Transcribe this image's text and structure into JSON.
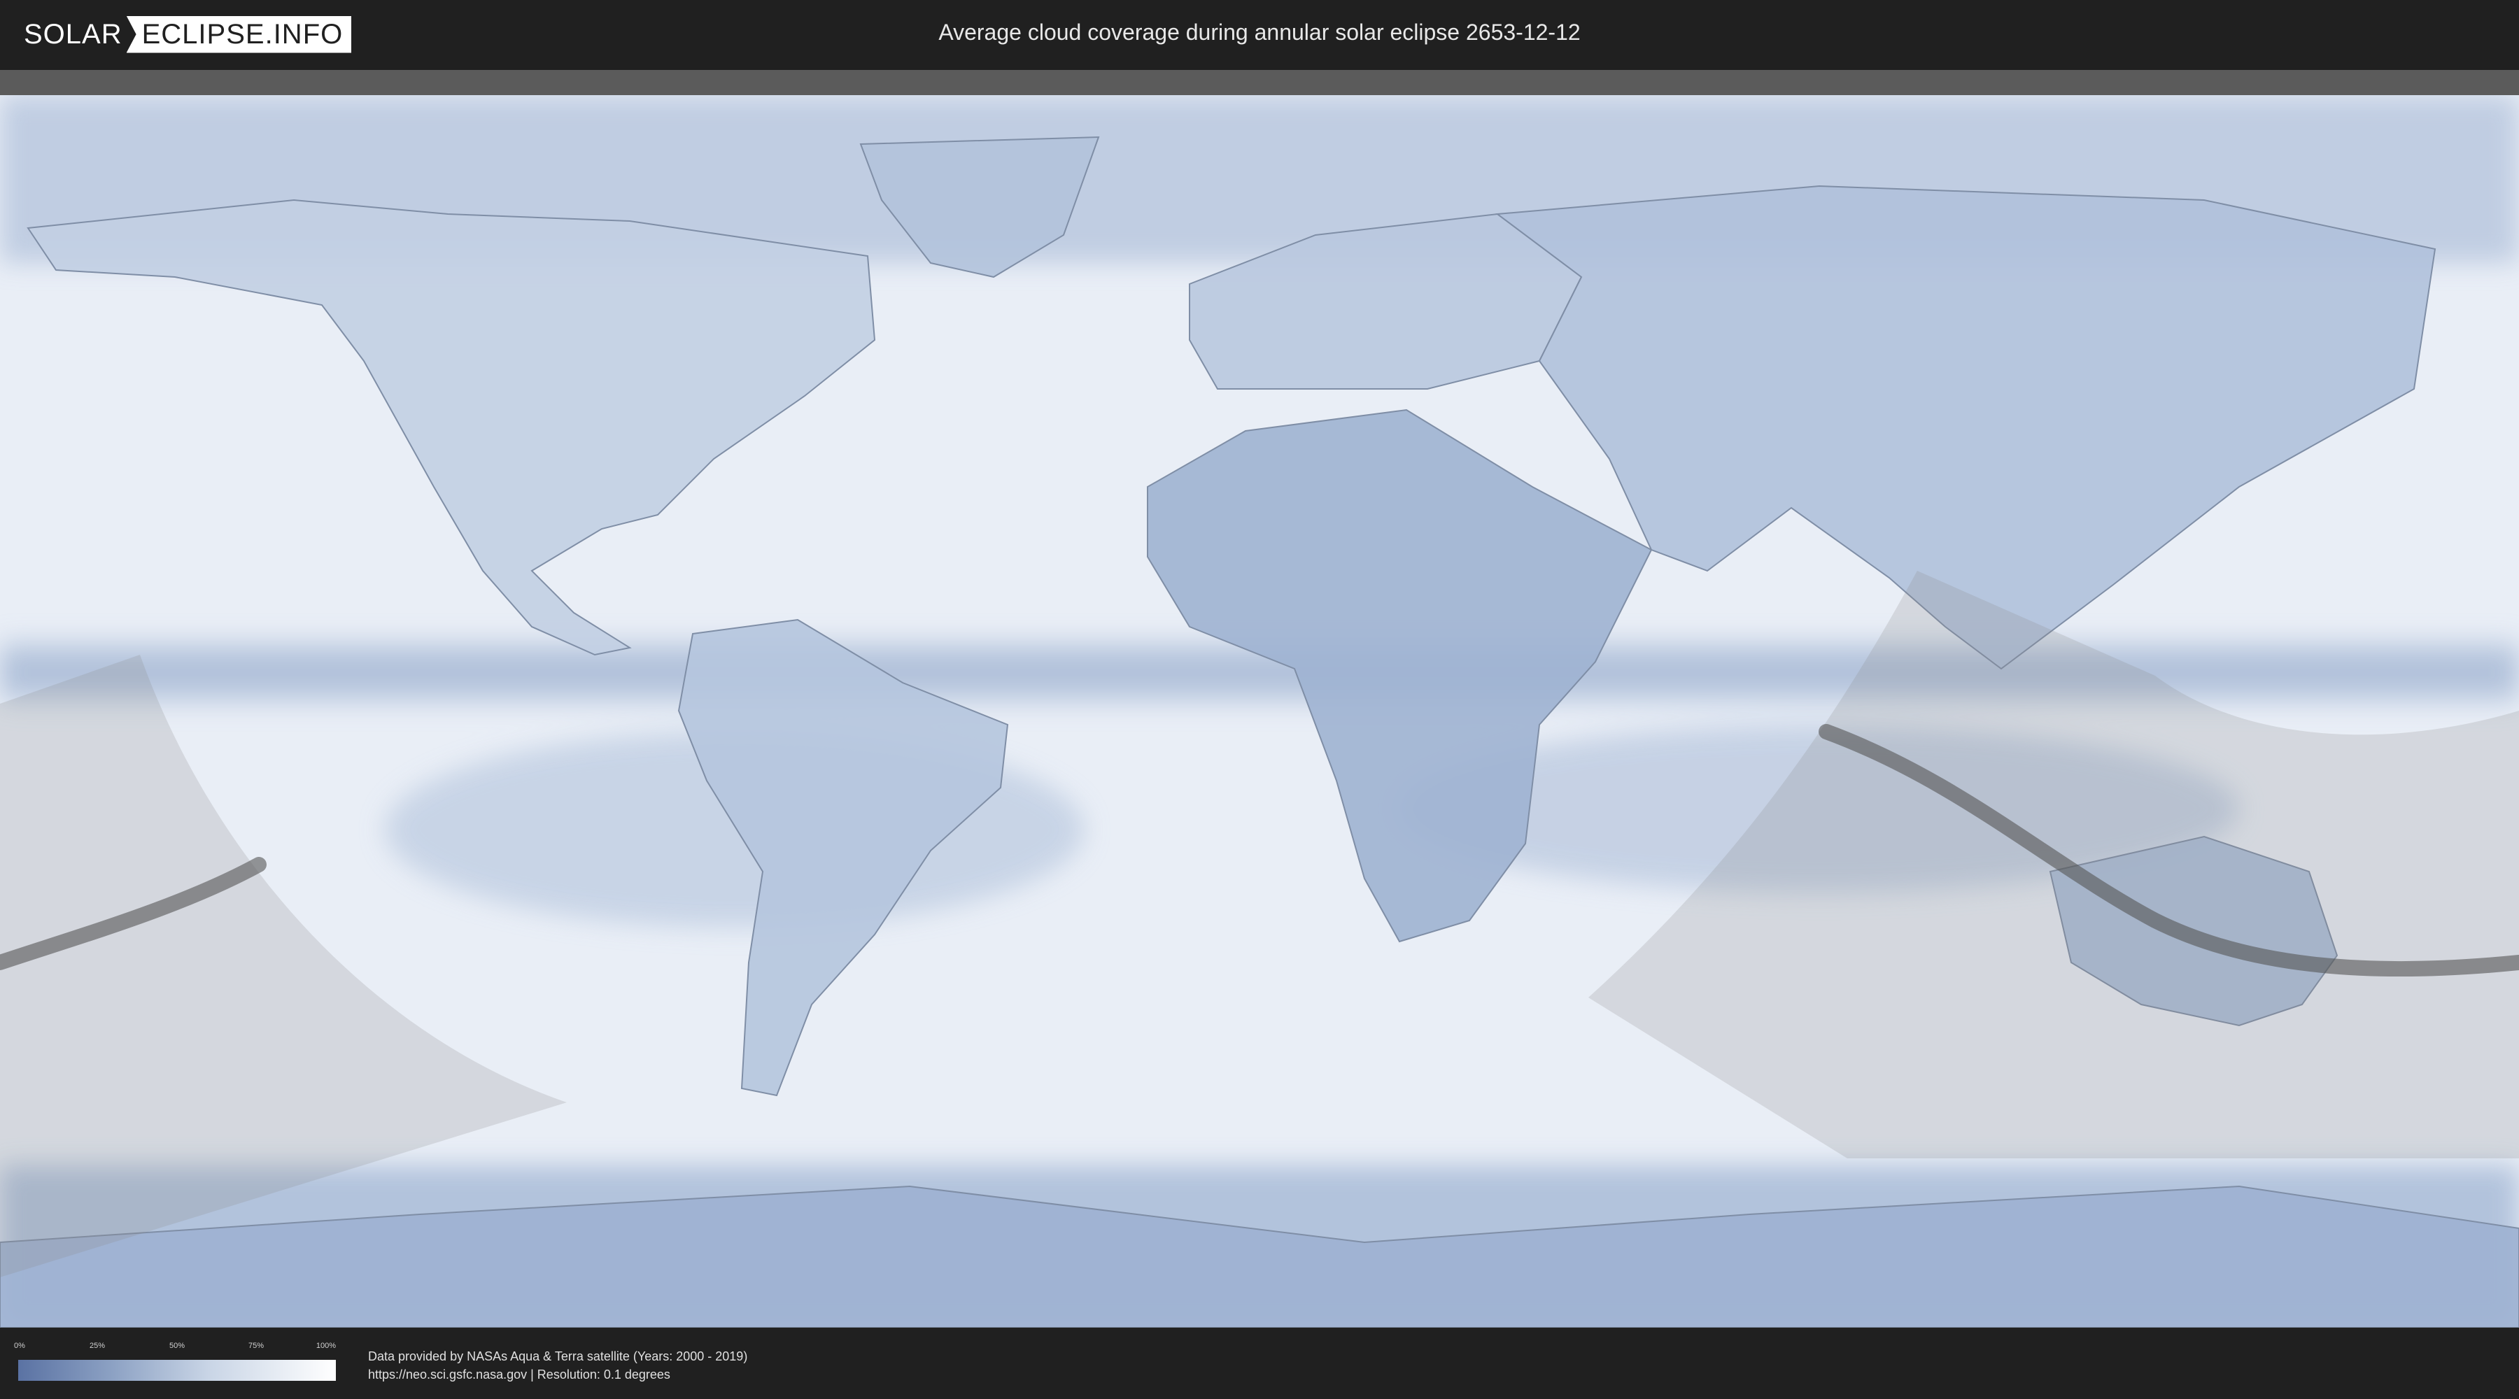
{
  "header": {
    "logo_left": "SOLAR",
    "logo_right": "ECLIPSE.INFO",
    "title": "Average cloud coverage during annular solar eclipse 2653-12-12"
  },
  "legend": {
    "ticks": [
      "0%",
      "25%",
      "50%",
      "75%",
      "100%"
    ],
    "colors": {
      "low": "#5a72a3",
      "mid": "#c9d5e6",
      "high": "#ffffff"
    }
  },
  "credits": {
    "line1": "Data provided by NASAs Aqua & Terra satellite (Years: 2000 - 2019)",
    "line2": "https://neo.sci.gsfc.nasa.gov | Resolution: 0.1 degrees"
  },
  "map": {
    "projection": "equirectangular",
    "colors": {
      "ocean_clear": "#e8eef6",
      "cloud_dense": "#6f88b8",
      "land_outline": "#7f8ea6",
      "penumbra_shade": "#8a8a8a",
      "central_path": "#555555"
    }
  }
}
